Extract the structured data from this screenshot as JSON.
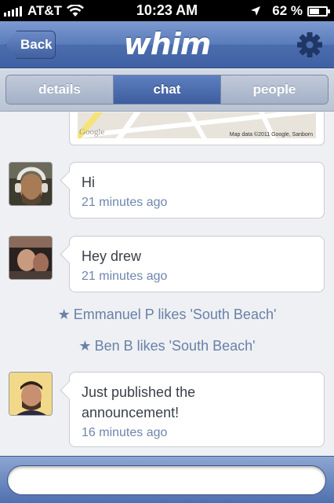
{
  "status_bar": {
    "carrier": "AT&T",
    "time": "10:23 AM",
    "battery_percent": "62 %",
    "battery_level": 0.62,
    "icons": [
      "signal-bars-icon",
      "wifi-icon",
      "location-arrow-icon",
      "battery-icon"
    ]
  },
  "nav": {
    "back_label": "Back",
    "logo": "whim",
    "settings_icon": "gear-icon"
  },
  "tabs": [
    {
      "label": "details",
      "active": false
    },
    {
      "label": "chat",
      "active": true
    },
    {
      "label": "people",
      "active": false
    }
  ],
  "map": {
    "credit": "Map data ©2011 Google, Sanborn",
    "logo": "Google"
  },
  "feed": [
    {
      "type": "message",
      "text": "Hi",
      "time": "21 minutes ago"
    },
    {
      "type": "message",
      "text": "Hey drew",
      "time": "21 minutes ago"
    },
    {
      "type": "activity",
      "text": "Emmanuel P likes 'South Beach'"
    },
    {
      "type": "activity",
      "text": "Ben B likes 'South Beach'"
    },
    {
      "type": "message",
      "text": "Just published the announcement!",
      "time": "16 minutes ago"
    }
  ],
  "colors": {
    "accent": "#4b6dae",
    "time_text": "#6e86ad",
    "message_text": "#3a3f47"
  }
}
